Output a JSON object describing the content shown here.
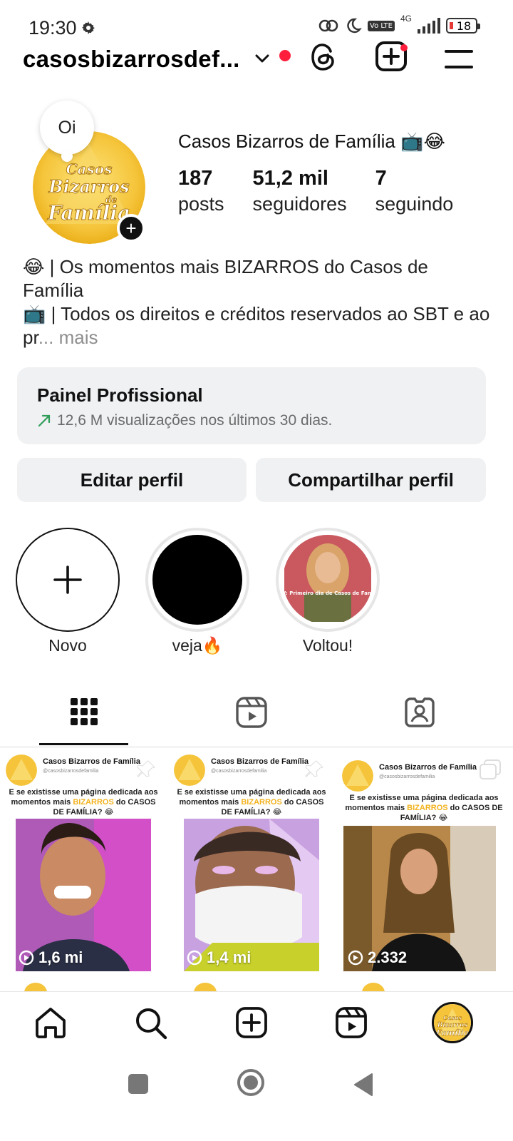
{
  "status_bar": {
    "time": "19:30",
    "network_type": "4G",
    "volte_label": "Vo LTE",
    "battery_level": "18"
  },
  "header": {
    "username": "casosbizarrosdef...",
    "icons": [
      "chevron-down-icon",
      "threads-icon",
      "create-icon",
      "menu-icon"
    ]
  },
  "profile": {
    "note": "Oi",
    "display_name": "Casos Bizarros de Família 📺😂",
    "avatar_text": [
      "Casos",
      "Bizarros",
      "de",
      "Família"
    ],
    "stats": [
      {
        "value": "187",
        "label": "posts"
      },
      {
        "value": "51,2 mil",
        "label": "seguidores"
      },
      {
        "value": "7",
        "label": "seguindo"
      }
    ],
    "bio_line1": "😂 | Os momentos mais BIZARROS do Casos de Família",
    "bio_line2": "📺 | Todos os direitos e créditos reservados ao SBT e ao pr",
    "bio_ellipsis": "...",
    "bio_more": "mais"
  },
  "dashboard": {
    "title": "Painel Profissional",
    "subtitle": "12,6 M visualizações nos últimos 30 dias.",
    "trend_color": "#2e9d5a"
  },
  "buttons": {
    "edit": "Editar perfil",
    "share": "Compartilhar perfil"
  },
  "highlights": [
    {
      "label": "Novo"
    },
    {
      "label": "veja🔥"
    },
    {
      "label": "Voltou!",
      "overlay_text": "POV: Primeiro dia de Casos de Família"
    }
  ],
  "tabs": [
    "grid-icon",
    "reels-icon",
    "tagged-icon"
  ],
  "posts": [
    {
      "account_name": "Casos Bizarros de Família",
      "account_handle": "@casosbizarrosdefamilia",
      "caption_pre": "E se existisse uma página dedicada aos momentos mais ",
      "caption_highlight": "BIZARROS",
      "caption_post": " do CASOS DE FAMÍLIA? 😂",
      "views": "1,6 mi"
    },
    {
      "account_name": "Casos Bizarros de Família",
      "account_handle": "@casosbizarrosdefamilia",
      "caption_pre": "E se existisse uma página dedicada aos momentos mais ",
      "caption_highlight": "BIZARROS",
      "caption_post": " do CASOS DE FAMÍLIA? 😂",
      "views": "1,4 mi"
    },
    {
      "account_name": "Casos Bizarros de Família",
      "account_handle": "@casosbizarrosdefamilia",
      "caption_pre": "E se existisse uma página dedicada aos momentos mais ",
      "caption_highlight": "BIZARROS",
      "caption_post": " do CASOS DE FAMÍLIA? 😂",
      "views": "2.332"
    }
  ],
  "bottom_nav": [
    "home-icon",
    "search-icon",
    "create-icon",
    "reels-icon",
    "profile-avatar"
  ],
  "colors": {
    "brand_gold": "#f2b21d",
    "notification_red": "#ff1f3d",
    "button_bg": "#eff1f3"
  }
}
